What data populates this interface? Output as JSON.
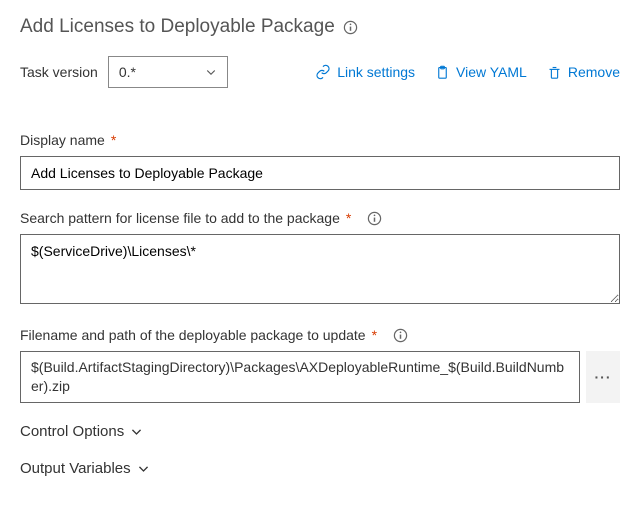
{
  "header": {
    "title": "Add Licenses to Deployable Package"
  },
  "taskVersion": {
    "label": "Task version",
    "value": "0.*"
  },
  "actions": {
    "link": "Link settings",
    "yaml": "View YAML",
    "remove": "Remove"
  },
  "displayName": {
    "label": "Display name",
    "value": "Add Licenses to Deployable Package"
  },
  "searchPattern": {
    "label": "Search pattern for license file to add to the package",
    "value": "$(ServiceDrive)\\Licenses\\*"
  },
  "filename": {
    "label": "Filename and path of the deployable package to update",
    "value": "$(Build.ArtifactStagingDirectory)\\Packages\\AXDeployableRuntime_$(Build.BuildNumber).zip"
  },
  "sections": {
    "control": "Control Options",
    "output": "Output Variables"
  },
  "glyphs": {
    "required": "*",
    "ellipsis": "···"
  }
}
